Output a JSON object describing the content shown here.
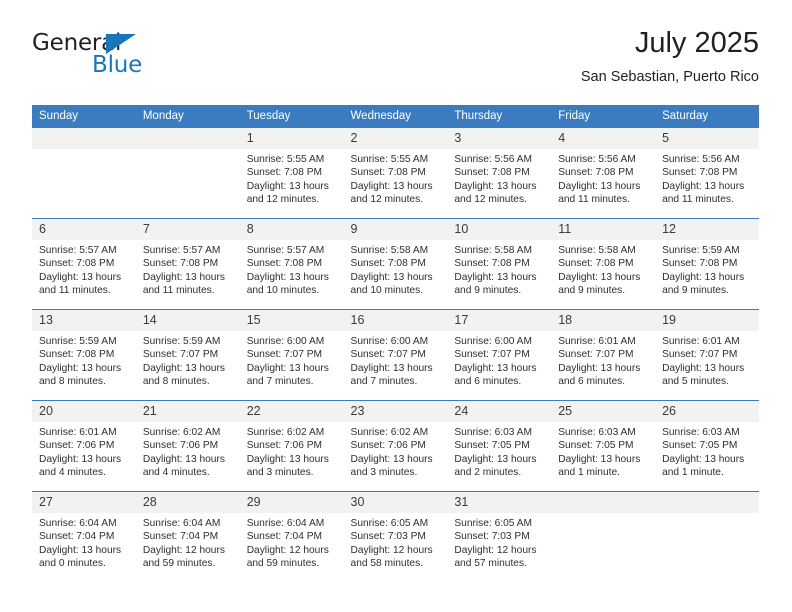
{
  "brand": {
    "name_part1": "General",
    "name_part2": "Blue",
    "accent_color": "#1b75bb"
  },
  "header": {
    "title": "July 2025",
    "subtitle": "San Sebastian, Puerto Rico"
  },
  "theme": {
    "header_blue": "#3b7cc0",
    "daynum_band": "#f2f2f2"
  },
  "weekdays": [
    "Sunday",
    "Monday",
    "Tuesday",
    "Wednesday",
    "Thursday",
    "Friday",
    "Saturday"
  ],
  "weeks": [
    [
      {
        "day": "",
        "lines": []
      },
      {
        "day": "",
        "lines": []
      },
      {
        "day": "1",
        "lines": [
          "Sunrise: 5:55 AM",
          "Sunset: 7:08 PM",
          "Daylight: 13 hours",
          "and 12 minutes."
        ]
      },
      {
        "day": "2",
        "lines": [
          "Sunrise: 5:55 AM",
          "Sunset: 7:08 PM",
          "Daylight: 13 hours",
          "and 12 minutes."
        ]
      },
      {
        "day": "3",
        "lines": [
          "Sunrise: 5:56 AM",
          "Sunset: 7:08 PM",
          "Daylight: 13 hours",
          "and 12 minutes."
        ]
      },
      {
        "day": "4",
        "lines": [
          "Sunrise: 5:56 AM",
          "Sunset: 7:08 PM",
          "Daylight: 13 hours",
          "and 11 minutes."
        ]
      },
      {
        "day": "5",
        "lines": [
          "Sunrise: 5:56 AM",
          "Sunset: 7:08 PM",
          "Daylight: 13 hours",
          "and 11 minutes."
        ]
      }
    ],
    [
      {
        "day": "6",
        "lines": [
          "Sunrise: 5:57 AM",
          "Sunset: 7:08 PM",
          "Daylight: 13 hours",
          "and 11 minutes."
        ]
      },
      {
        "day": "7",
        "lines": [
          "Sunrise: 5:57 AM",
          "Sunset: 7:08 PM",
          "Daylight: 13 hours",
          "and 11 minutes."
        ]
      },
      {
        "day": "8",
        "lines": [
          "Sunrise: 5:57 AM",
          "Sunset: 7:08 PM",
          "Daylight: 13 hours",
          "and 10 minutes."
        ]
      },
      {
        "day": "9",
        "lines": [
          "Sunrise: 5:58 AM",
          "Sunset: 7:08 PM",
          "Daylight: 13 hours",
          "and 10 minutes."
        ]
      },
      {
        "day": "10",
        "lines": [
          "Sunrise: 5:58 AM",
          "Sunset: 7:08 PM",
          "Daylight: 13 hours",
          "and 9 minutes."
        ]
      },
      {
        "day": "11",
        "lines": [
          "Sunrise: 5:58 AM",
          "Sunset: 7:08 PM",
          "Daylight: 13 hours",
          "and 9 minutes."
        ]
      },
      {
        "day": "12",
        "lines": [
          "Sunrise: 5:59 AM",
          "Sunset: 7:08 PM",
          "Daylight: 13 hours",
          "and 9 minutes."
        ]
      }
    ],
    [
      {
        "day": "13",
        "lines": [
          "Sunrise: 5:59 AM",
          "Sunset: 7:08 PM",
          "Daylight: 13 hours",
          "and 8 minutes."
        ]
      },
      {
        "day": "14",
        "lines": [
          "Sunrise: 5:59 AM",
          "Sunset: 7:07 PM",
          "Daylight: 13 hours",
          "and 8 minutes."
        ]
      },
      {
        "day": "15",
        "lines": [
          "Sunrise: 6:00 AM",
          "Sunset: 7:07 PM",
          "Daylight: 13 hours",
          "and 7 minutes."
        ]
      },
      {
        "day": "16",
        "lines": [
          "Sunrise: 6:00 AM",
          "Sunset: 7:07 PM",
          "Daylight: 13 hours",
          "and 7 minutes."
        ]
      },
      {
        "day": "17",
        "lines": [
          "Sunrise: 6:00 AM",
          "Sunset: 7:07 PM",
          "Daylight: 13 hours",
          "and 6 minutes."
        ]
      },
      {
        "day": "18",
        "lines": [
          "Sunrise: 6:01 AM",
          "Sunset: 7:07 PM",
          "Daylight: 13 hours",
          "and 6 minutes."
        ]
      },
      {
        "day": "19",
        "lines": [
          "Sunrise: 6:01 AM",
          "Sunset: 7:07 PM",
          "Daylight: 13 hours",
          "and 5 minutes."
        ]
      }
    ],
    [
      {
        "day": "20",
        "lines": [
          "Sunrise: 6:01 AM",
          "Sunset: 7:06 PM",
          "Daylight: 13 hours",
          "and 4 minutes."
        ]
      },
      {
        "day": "21",
        "lines": [
          "Sunrise: 6:02 AM",
          "Sunset: 7:06 PM",
          "Daylight: 13 hours",
          "and 4 minutes."
        ]
      },
      {
        "day": "22",
        "lines": [
          "Sunrise: 6:02 AM",
          "Sunset: 7:06 PM",
          "Daylight: 13 hours",
          "and 3 minutes."
        ]
      },
      {
        "day": "23",
        "lines": [
          "Sunrise: 6:02 AM",
          "Sunset: 7:06 PM",
          "Daylight: 13 hours",
          "and 3 minutes."
        ]
      },
      {
        "day": "24",
        "lines": [
          "Sunrise: 6:03 AM",
          "Sunset: 7:05 PM",
          "Daylight: 13 hours",
          "and 2 minutes."
        ]
      },
      {
        "day": "25",
        "lines": [
          "Sunrise: 6:03 AM",
          "Sunset: 7:05 PM",
          "Daylight: 13 hours",
          "and 1 minute."
        ]
      },
      {
        "day": "26",
        "lines": [
          "Sunrise: 6:03 AM",
          "Sunset: 7:05 PM",
          "Daylight: 13 hours",
          "and 1 minute."
        ]
      }
    ],
    [
      {
        "day": "27",
        "lines": [
          "Sunrise: 6:04 AM",
          "Sunset: 7:04 PM",
          "Daylight: 13 hours",
          "and 0 minutes."
        ]
      },
      {
        "day": "28",
        "lines": [
          "Sunrise: 6:04 AM",
          "Sunset: 7:04 PM",
          "Daylight: 12 hours",
          "and 59 minutes."
        ]
      },
      {
        "day": "29",
        "lines": [
          "Sunrise: 6:04 AM",
          "Sunset: 7:04 PM",
          "Daylight: 12 hours",
          "and 59 minutes."
        ]
      },
      {
        "day": "30",
        "lines": [
          "Sunrise: 6:05 AM",
          "Sunset: 7:03 PM",
          "Daylight: 12 hours",
          "and 58 minutes."
        ]
      },
      {
        "day": "31",
        "lines": [
          "Sunrise: 6:05 AM",
          "Sunset: 7:03 PM",
          "Daylight: 12 hours",
          "and 57 minutes."
        ]
      },
      {
        "day": "",
        "lines": []
      },
      {
        "day": "",
        "lines": []
      }
    ]
  ]
}
